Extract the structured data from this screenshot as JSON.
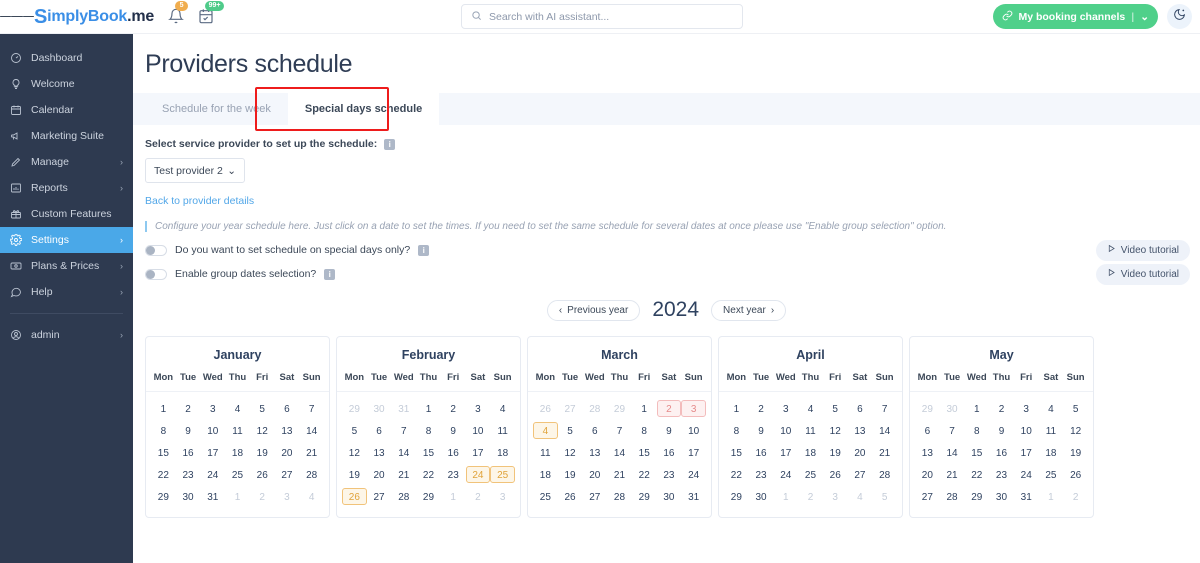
{
  "topbar": {
    "brand_s": "S",
    "brand_part1": "implyBook",
    "brand_part2": ".me",
    "bell_badge": "5",
    "calendar_badge": "99+",
    "search_placeholder": "Search with AI assistant...",
    "search_value": "",
    "booking_button": "My booking channels",
    "booking_divider": "|",
    "booking_caret": "⌄",
    "theme_icon": "moon-icon"
  },
  "sidebar": {
    "items": [
      {
        "label": "Dashboard",
        "icon": "gauge-icon",
        "chevron": false,
        "active": false
      },
      {
        "label": "Welcome",
        "icon": "bulb-icon",
        "chevron": false,
        "active": false
      },
      {
        "label": "Calendar",
        "icon": "calendar-icon",
        "chevron": false,
        "active": false
      },
      {
        "label": "Marketing Suite",
        "icon": "megaphone-icon",
        "chevron": false,
        "active": false
      },
      {
        "label": "Manage",
        "icon": "pencil-icon",
        "chevron": true,
        "active": false
      },
      {
        "label": "Reports",
        "icon": "chart-icon",
        "chevron": true,
        "active": false
      },
      {
        "label": "Custom Features",
        "icon": "gift-icon",
        "chevron": false,
        "active": false
      },
      {
        "label": "Settings",
        "icon": "gear-icon",
        "chevron": true,
        "active": true
      },
      {
        "label": "Plans & Prices",
        "icon": "money-icon",
        "chevron": true,
        "active": false
      },
      {
        "label": "Help",
        "icon": "chat-icon",
        "chevron": true,
        "active": false
      }
    ],
    "account": {
      "label": "admin",
      "icon": "user-icon",
      "chevron": true
    }
  },
  "main": {
    "page_title": "Providers schedule",
    "tabs": [
      {
        "label": "Schedule for the week",
        "active": false
      },
      {
        "label": "Special days schedule",
        "active": true
      }
    ],
    "select_label": "Select service provider to set up the schedule:",
    "provider_value": "Test provider 2",
    "provider_caret": "⌄",
    "back_link": "Back to provider details",
    "note": "Configure your year schedule here. Just click on a date to set the times. If you need to set the same schedule for several dates at once please use \"Enable group selection\" option.",
    "toggles": [
      {
        "label": "Do you want to set schedule on special days only?",
        "on": false,
        "video_label": "Video tutorial"
      },
      {
        "label": "Enable group dates selection?",
        "on": false,
        "video_label": "Video tutorial"
      }
    ],
    "year_nav": {
      "prev_label": "Previous year",
      "next_label": "Next year",
      "year": "2024"
    },
    "dow": [
      "Mon",
      "Tue",
      "Wed",
      "Thu",
      "Fri",
      "Sat",
      "Sun"
    ],
    "months": [
      {
        "name": "January",
        "days": [
          {
            "n": "1"
          },
          {
            "n": "2"
          },
          {
            "n": "3"
          },
          {
            "n": "4"
          },
          {
            "n": "5"
          },
          {
            "n": "6"
          },
          {
            "n": "7"
          },
          {
            "n": "8"
          },
          {
            "n": "9"
          },
          {
            "n": "10"
          },
          {
            "n": "11"
          },
          {
            "n": "12"
          },
          {
            "n": "13"
          },
          {
            "n": "14"
          },
          {
            "n": "15"
          },
          {
            "n": "16"
          },
          {
            "n": "17"
          },
          {
            "n": "18"
          },
          {
            "n": "19"
          },
          {
            "n": "20"
          },
          {
            "n": "21"
          },
          {
            "n": "22"
          },
          {
            "n": "23"
          },
          {
            "n": "24"
          },
          {
            "n": "25"
          },
          {
            "n": "26"
          },
          {
            "n": "27"
          },
          {
            "n": "28"
          },
          {
            "n": "29"
          },
          {
            "n": "30"
          },
          {
            "n": "31"
          },
          {
            "n": "1",
            "out": true
          },
          {
            "n": "2",
            "out": true
          },
          {
            "n": "3",
            "out": true
          },
          {
            "n": "4",
            "out": true
          }
        ]
      },
      {
        "name": "February",
        "days": [
          {
            "n": "29",
            "out": true
          },
          {
            "n": "30",
            "out": true
          },
          {
            "n": "31",
            "out": true
          },
          {
            "n": "1"
          },
          {
            "n": "2"
          },
          {
            "n": "3"
          },
          {
            "n": "4"
          },
          {
            "n": "5"
          },
          {
            "n": "6"
          },
          {
            "n": "7"
          },
          {
            "n": "8"
          },
          {
            "n": "9"
          },
          {
            "n": "10"
          },
          {
            "n": "11"
          },
          {
            "n": "12"
          },
          {
            "n": "13"
          },
          {
            "n": "14"
          },
          {
            "n": "15"
          },
          {
            "n": "16"
          },
          {
            "n": "17"
          },
          {
            "n": "18"
          },
          {
            "n": "19"
          },
          {
            "n": "20"
          },
          {
            "n": "21"
          },
          {
            "n": "22"
          },
          {
            "n": "23"
          },
          {
            "n": "24",
            "hl": "amber"
          },
          {
            "n": "25",
            "hl": "amber"
          },
          {
            "n": "26",
            "hl": "amber"
          },
          {
            "n": "27"
          },
          {
            "n": "28"
          },
          {
            "n": "29"
          },
          {
            "n": "1",
            "out": true
          },
          {
            "n": "2",
            "out": true
          },
          {
            "n": "3",
            "out": true
          }
        ]
      },
      {
        "name": "March",
        "days": [
          {
            "n": "26",
            "out": true
          },
          {
            "n": "27",
            "out": true
          },
          {
            "n": "28",
            "out": true
          },
          {
            "n": "29",
            "out": true
          },
          {
            "n": "1"
          },
          {
            "n": "2",
            "hl": "red"
          },
          {
            "n": "3",
            "hl": "red"
          },
          {
            "n": "4",
            "hl": "amber"
          },
          {
            "n": "5"
          },
          {
            "n": "6"
          },
          {
            "n": "7"
          },
          {
            "n": "8"
          },
          {
            "n": "9"
          },
          {
            "n": "10"
          },
          {
            "n": "11"
          },
          {
            "n": "12"
          },
          {
            "n": "13"
          },
          {
            "n": "14"
          },
          {
            "n": "15"
          },
          {
            "n": "16"
          },
          {
            "n": "17"
          },
          {
            "n": "18"
          },
          {
            "n": "19"
          },
          {
            "n": "20"
          },
          {
            "n": "21"
          },
          {
            "n": "22"
          },
          {
            "n": "23"
          },
          {
            "n": "24"
          },
          {
            "n": "25"
          },
          {
            "n": "26"
          },
          {
            "n": "27"
          },
          {
            "n": "28"
          },
          {
            "n": "29"
          },
          {
            "n": "30"
          },
          {
            "n": "31"
          }
        ]
      },
      {
        "name": "April",
        "days": [
          {
            "n": "1"
          },
          {
            "n": "2"
          },
          {
            "n": "3"
          },
          {
            "n": "4"
          },
          {
            "n": "5"
          },
          {
            "n": "6"
          },
          {
            "n": "7"
          },
          {
            "n": "8"
          },
          {
            "n": "9"
          },
          {
            "n": "10"
          },
          {
            "n": "11"
          },
          {
            "n": "12"
          },
          {
            "n": "13"
          },
          {
            "n": "14"
          },
          {
            "n": "15"
          },
          {
            "n": "16"
          },
          {
            "n": "17"
          },
          {
            "n": "18"
          },
          {
            "n": "19"
          },
          {
            "n": "20"
          },
          {
            "n": "21"
          },
          {
            "n": "22"
          },
          {
            "n": "23"
          },
          {
            "n": "24"
          },
          {
            "n": "25"
          },
          {
            "n": "26"
          },
          {
            "n": "27"
          },
          {
            "n": "28"
          },
          {
            "n": "29"
          },
          {
            "n": "30"
          },
          {
            "n": "1",
            "out": true
          },
          {
            "n": "2",
            "out": true
          },
          {
            "n": "3",
            "out": true
          },
          {
            "n": "4",
            "out": true
          },
          {
            "n": "5",
            "out": true
          }
        ]
      },
      {
        "name": "May",
        "days": [
          {
            "n": "29",
            "out": true
          },
          {
            "n": "30",
            "out": true
          },
          {
            "n": "1"
          },
          {
            "n": "2"
          },
          {
            "n": "3"
          },
          {
            "n": "4"
          },
          {
            "n": "5"
          },
          {
            "n": "6"
          },
          {
            "n": "7"
          },
          {
            "n": "8"
          },
          {
            "n": "9"
          },
          {
            "n": "10"
          },
          {
            "n": "11"
          },
          {
            "n": "12"
          },
          {
            "n": "13"
          },
          {
            "n": "14"
          },
          {
            "n": "15"
          },
          {
            "n": "16"
          },
          {
            "n": "17"
          },
          {
            "n": "18"
          },
          {
            "n": "19"
          },
          {
            "n": "20"
          },
          {
            "n": "21"
          },
          {
            "n": "22"
          },
          {
            "n": "23"
          },
          {
            "n": "24"
          },
          {
            "n": "25"
          },
          {
            "n": "26"
          },
          {
            "n": "27"
          },
          {
            "n": "28"
          },
          {
            "n": "29"
          },
          {
            "n": "30"
          },
          {
            "n": "31"
          },
          {
            "n": "1",
            "out": true
          },
          {
            "n": "2",
            "out": true
          }
        ]
      }
    ]
  },
  "colors": {
    "sidebar_bg": "#2e3a50",
    "accent_blue": "#4aa8e8",
    "brand_green": "#4fd08a",
    "highlight_amber": "#f1c37a",
    "highlight_red": "#f3bcbc",
    "tab_outline_red": "#ee1c1c"
  }
}
